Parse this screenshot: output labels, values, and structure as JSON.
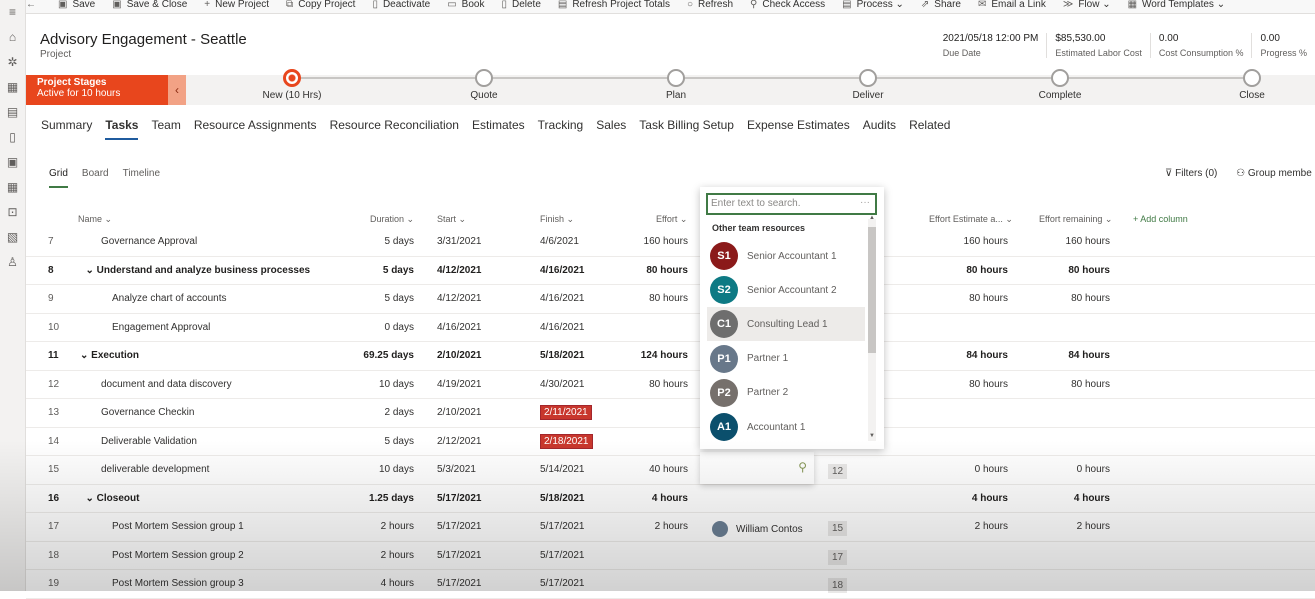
{
  "leftnav": [
    "≡",
    "⌂",
    "✲",
    "▦",
    "▤",
    "▯",
    "▣",
    "▦",
    "⊡",
    "▧",
    "♙"
  ],
  "commands": [
    {
      "icon": "back-icon",
      "glyph": "←",
      "label": ""
    },
    {
      "icon": "save-icon",
      "glyph": "▣",
      "label": "Save"
    },
    {
      "icon": "save-close-icon",
      "glyph": "▣",
      "label": "Save & Close"
    },
    {
      "icon": "plus-icon",
      "glyph": "+",
      "label": "New Project"
    },
    {
      "icon": "copy-icon",
      "glyph": "⧉",
      "label": "Copy Project"
    },
    {
      "icon": "deactivate-icon",
      "glyph": "▯",
      "label": "Deactivate"
    },
    {
      "icon": "book-icon",
      "glyph": "▭",
      "label": "Book"
    },
    {
      "icon": "delete-icon",
      "glyph": "▯",
      "label": "Delete"
    },
    {
      "icon": "refresh-totals-icon",
      "glyph": "▤",
      "label": "Refresh Project Totals"
    },
    {
      "icon": "refresh-icon",
      "glyph": "○",
      "label": "Refresh"
    },
    {
      "icon": "check-access-icon",
      "glyph": "⚲",
      "label": "Check Access"
    },
    {
      "icon": "process-icon",
      "glyph": "▤",
      "label": "Process ⌄"
    },
    {
      "icon": "share-icon",
      "glyph": "⇗",
      "label": "Share"
    },
    {
      "icon": "email-icon",
      "glyph": "✉",
      "label": "Email a Link"
    },
    {
      "icon": "flow-icon",
      "glyph": "≫",
      "label": "Flow ⌄"
    },
    {
      "icon": "word-templates-icon",
      "glyph": "▦",
      "label": "Word Templates ⌄"
    }
  ],
  "header": {
    "title": "Advisory Engagement - Seattle",
    "entity": "Project",
    "kpis": [
      {
        "value": "2021/05/18 12:00 PM",
        "label": "Due Date"
      },
      {
        "value": "$85,530.00",
        "label": "Estimated Labor Cost"
      },
      {
        "value": "0.00",
        "label": "Cost Consumption %"
      },
      {
        "value": "0.00",
        "label": "Progress %"
      }
    ]
  },
  "bpf": {
    "title": "Project Stages",
    "subtitle": "Active for 10 hours",
    "active_color": "#e8461d",
    "stages": [
      "New  (10 Hrs)",
      "Quote",
      "Plan",
      "Deliver",
      "Complete",
      "Close"
    ],
    "active_index": 0
  },
  "tabs": [
    "Summary",
    "Tasks",
    "Team",
    "Resource Assignments",
    "Resource Reconciliation",
    "Estimates",
    "Tracking",
    "Sales",
    "Task Billing Setup",
    "Expense Estimates",
    "Audits",
    "Related"
  ],
  "selected_tab": "Tasks",
  "views": [
    "Grid",
    "Board",
    "Timeline"
  ],
  "filters": {
    "filters": "Filters (0)",
    "group": "Group membe"
  },
  "columns": {
    "name": "Name ⌄",
    "duration": "Duration ⌄",
    "start": "Start ⌄",
    "finish": "Finish ⌄",
    "effort": "Effort ⌄",
    "effort_est": "Effort Estimate a... ⌄",
    "effort_rem": "Effort remaining ⌄",
    "add": "+ Add column"
  },
  "rows": [
    {
      "num": "7",
      "name": "Governance Approval",
      "indent": 1,
      "dur": "5 days",
      "start": "3/31/2021",
      "finish": "4/6/2021",
      "effort": "160 hours",
      "est": "160 hours",
      "rem": "160 hours"
    },
    {
      "num": "8",
      "name": "⌄ Understand and analyze business processes",
      "indent": 0.5,
      "sum": true,
      "dur": "5 days",
      "start": "4/12/2021",
      "finish": "4/16/2021",
      "effort": "80 hours",
      "est": "80 hours",
      "rem": "80 hours"
    },
    {
      "num": "9",
      "name": "Analyze chart of accounts",
      "indent": 2,
      "dur": "5 days",
      "start": "4/12/2021",
      "finish": "4/16/2021",
      "effort": "80 hours",
      "est": "80 hours",
      "rem": "80 hours"
    },
    {
      "num": "10",
      "name": "Engagement Approval",
      "indent": 2,
      "dur": "0 days",
      "start": "4/16/2021",
      "finish": "4/16/2021"
    },
    {
      "num": "11",
      "name": "⌄ Execution",
      "indent": 0,
      "sum": true,
      "dur": "69.25 days",
      "start": "2/10/2021",
      "finish": "5/18/2021",
      "effort": "124 hours",
      "est": "84 hours",
      "rem": "84 hours"
    },
    {
      "num": "12",
      "name": "document and data discovery",
      "indent": 1,
      "dur": "10 days",
      "start": "4/19/2021",
      "finish": "4/30/2021",
      "effort": "80 hours",
      "est": "80 hours",
      "rem": "80 hours"
    },
    {
      "num": "13",
      "name": "Governance Checkin",
      "indent": 1,
      "dur": "2 days",
      "start": "2/10/2021",
      "finish": "2/11/2021",
      "late": true
    },
    {
      "num": "14",
      "name": "Deliverable Validation",
      "indent": 1,
      "dur": "5 days",
      "start": "2/12/2021",
      "finish": "2/18/2021",
      "late": true
    },
    {
      "num": "15",
      "name": "deliverable development",
      "indent": 1,
      "dur": "10 days",
      "start": "5/3/2021",
      "finish": "5/14/2021",
      "effort": "40 hours",
      "id": "12",
      "est": "0 hours",
      "rem": "0 hours"
    },
    {
      "num": "16",
      "name": "⌄ Closeout",
      "indent": 0.5,
      "sum": true,
      "dur": "1.25 days",
      "start": "5/17/2021",
      "finish": "5/18/2021",
      "effort": "4 hours",
      "est": "4 hours",
      "rem": "4 hours"
    },
    {
      "num": "17",
      "name": "Post Mortem Session group 1",
      "indent": 2,
      "dur": "2 hours",
      "start": "5/17/2021",
      "finish": "5/17/2021",
      "effort": "2 hours",
      "assignee": "William Contos",
      "id": "15",
      "est": "2 hours",
      "rem": "2 hours"
    },
    {
      "num": "18",
      "name": "Post Mortem Session group 2",
      "indent": 2,
      "dur": "2 hours",
      "start": "5/17/2021",
      "finish": "5/17/2021",
      "id": "17"
    },
    {
      "num": "19",
      "name": "Post Mortem Session group 3",
      "indent": 2,
      "dur": "4 hours",
      "start": "5/17/2021",
      "finish": "5/17/2021",
      "id": "18"
    }
  ],
  "dropdown": {
    "placeholder": "Enter text to search.",
    "more": "···",
    "section": "Other team resources",
    "options": [
      {
        "initials": "S1",
        "name": "Senior Accountant 1",
        "color": "#8b1a1a"
      },
      {
        "initials": "S2",
        "name": "Senior Accountant 2",
        "color": "#0e7a84"
      },
      {
        "initials": "C1",
        "name": "Consulting Lead 1",
        "color": "#6e6e6e",
        "hover": true
      },
      {
        "initials": "P1",
        "name": "Partner 1",
        "color": "#68788a"
      },
      {
        "initials": "P2",
        "name": "Partner 2",
        "color": "#76706c"
      },
      {
        "initials": "A1",
        "name": "Accountant 1",
        "color": "#0b4f6c"
      }
    ]
  }
}
